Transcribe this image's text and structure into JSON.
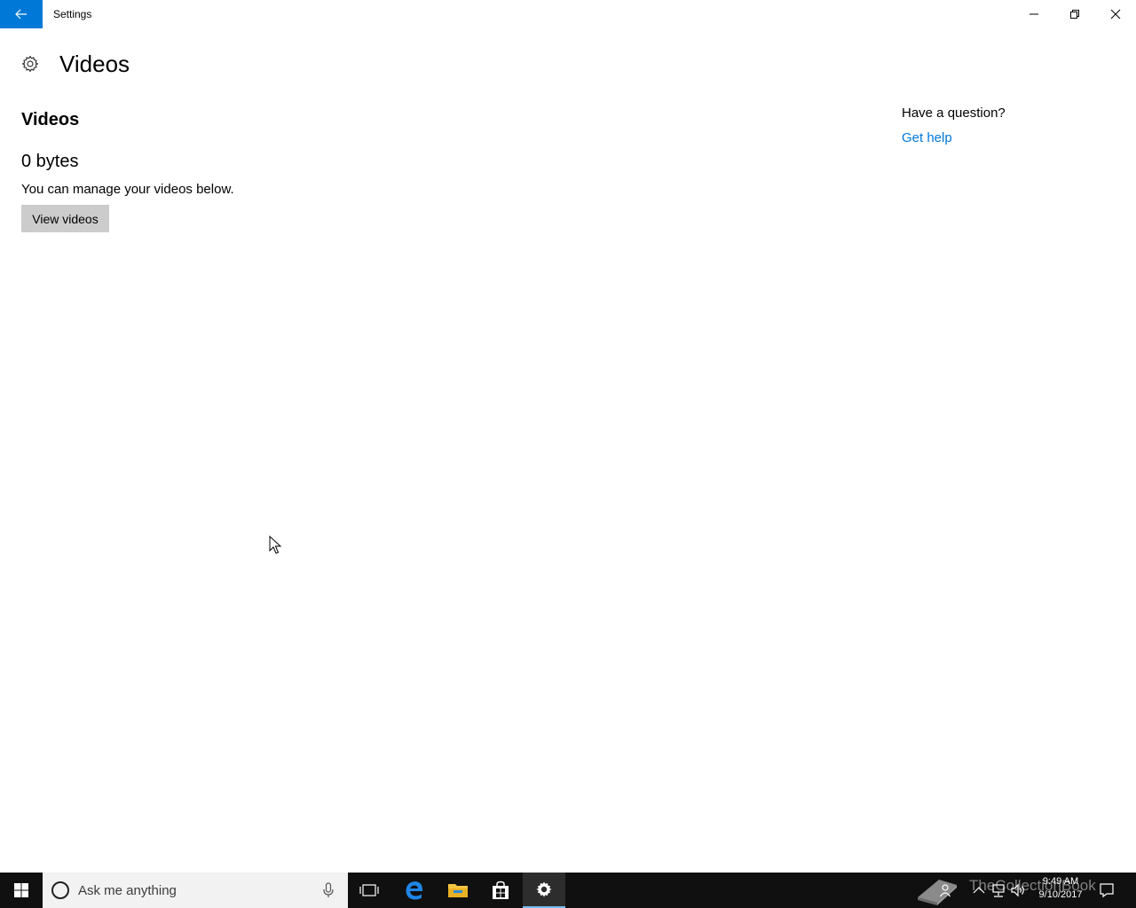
{
  "window": {
    "title": "Settings"
  },
  "page": {
    "title": "Videos",
    "section_title": "Videos",
    "size_value": "0 bytes",
    "description": "You can manage your videos below.",
    "view_button_label": "View videos"
  },
  "help": {
    "question": "Have a question?",
    "link_label": "Get help"
  },
  "taskbar": {
    "search_placeholder": "Ask me anything",
    "time": "9:49 AM",
    "date": "9/10/2017",
    "watermark": "TheCollectionBook",
    "pinned_apps": [
      "task-view",
      "edge",
      "file-explorer",
      "store",
      "settings"
    ],
    "active_app": "settings"
  },
  "colors": {
    "accent": "#0078d7",
    "button_gray": "#cccccc",
    "taskbar": "#101010",
    "search_box": "#f2f2f2"
  }
}
